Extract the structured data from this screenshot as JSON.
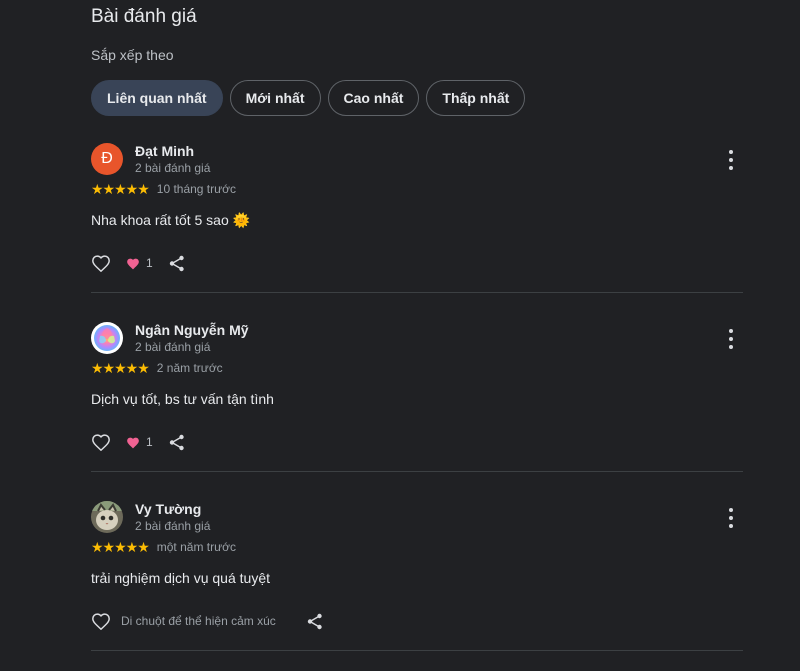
{
  "section": {
    "title": "Bài đánh giá",
    "sort_label": "Sắp xếp theo",
    "sort_options": [
      {
        "label": "Liên quan nhất",
        "active": true
      },
      {
        "label": "Mới nhất",
        "active": false
      },
      {
        "label": "Cao nhất",
        "active": false
      },
      {
        "label": "Thấp nhất",
        "active": false
      }
    ]
  },
  "reviews": [
    {
      "name": "Đạt Minh",
      "avatar_letter": "Đ",
      "avatar_color": "#e8552b",
      "review_count": "2 bài đánh giá",
      "rating": 5,
      "stars": "★★★★★",
      "time": "10 tháng trước",
      "text": "Nha khoa rất tốt 5 sao 🌞",
      "reaction_count": "1"
    },
    {
      "name": "Ngân Nguyễn Mỹ",
      "avatar_icon": "rainbow-rose-avatar",
      "review_count": "2 bài đánh giá",
      "rating": 5,
      "stars": "★★★★★",
      "time": "2 năm trước",
      "text": "Dịch vụ tốt, bs tư vấn tận tình",
      "reaction_count": "1"
    },
    {
      "name": "Vy Tường",
      "avatar_icon": "cat-photo-avatar",
      "review_count": "2 bài đánh giá",
      "rating": 5,
      "stars": "★★★★★",
      "time": "một năm trước",
      "text": "trải nghiệm dịch vụ quá tuyệt",
      "reaction_hint": "Di chuột để thể hiện cảm xúc"
    }
  ],
  "colors": {
    "background": "#202124",
    "star": "#fbbc04",
    "active_chip": "#394457",
    "heart": "#f06292"
  }
}
